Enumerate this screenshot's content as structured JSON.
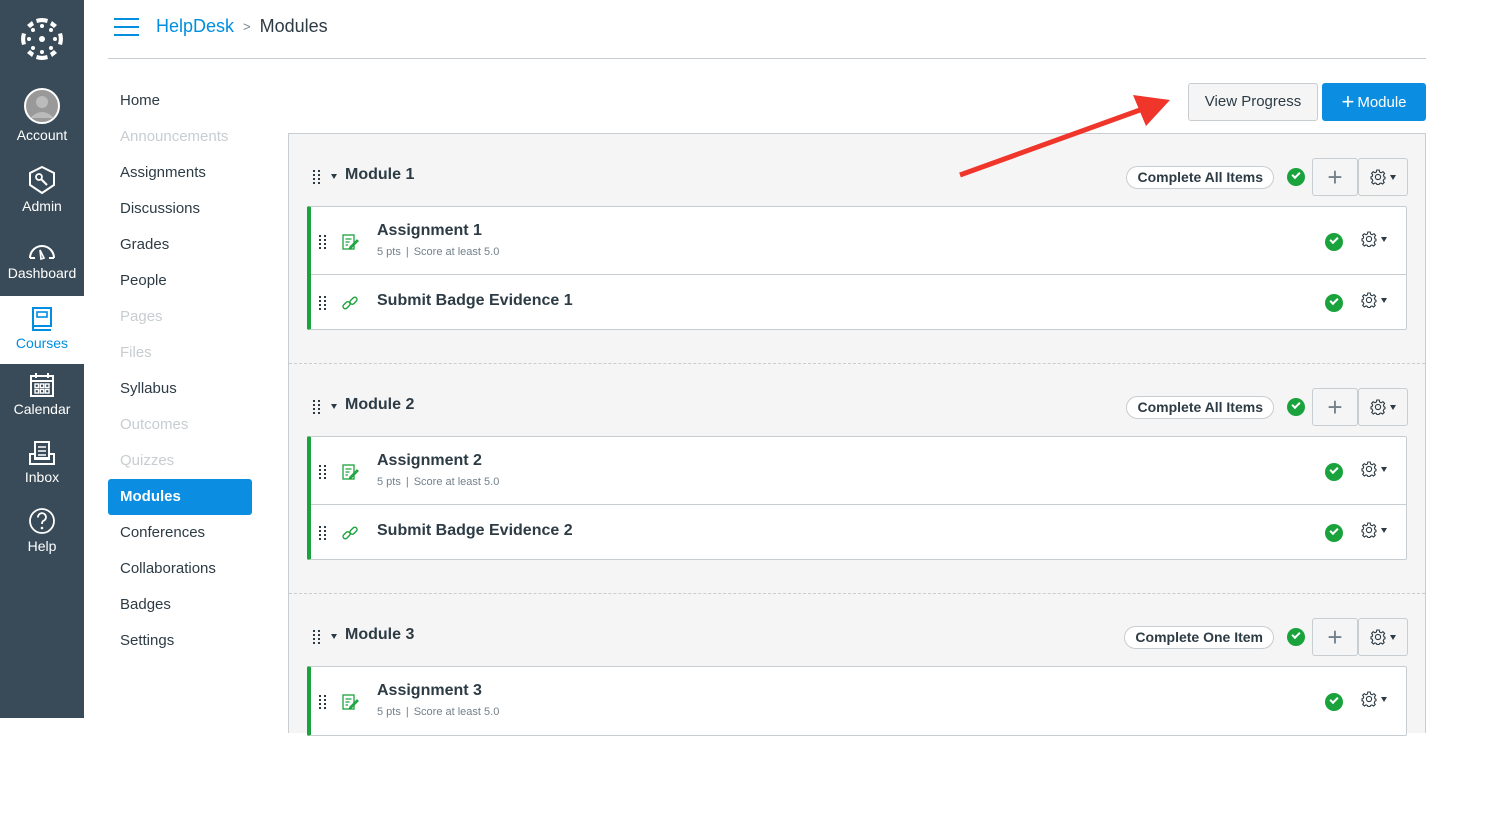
{
  "global_nav": {
    "items": [
      {
        "label": "Account",
        "icon": "avatar-icon"
      },
      {
        "label": "Admin",
        "icon": "shield-key-icon"
      },
      {
        "label": "Dashboard",
        "icon": "speedometer-icon"
      },
      {
        "label": "Courses",
        "icon": "book-icon",
        "active": true
      },
      {
        "label": "Calendar",
        "icon": "calendar-icon"
      },
      {
        "label": "Inbox",
        "icon": "inbox-icon"
      },
      {
        "label": "Help",
        "icon": "question-circle-icon"
      }
    ]
  },
  "breadcrumb": {
    "course": "HelpDesk",
    "separator": ">",
    "current": "Modules"
  },
  "course_nav": {
    "items": [
      {
        "label": "Home",
        "state": "enabled"
      },
      {
        "label": "Announcements",
        "state": "disabled"
      },
      {
        "label": "Assignments",
        "state": "enabled"
      },
      {
        "label": "Discussions",
        "state": "enabled"
      },
      {
        "label": "Grades",
        "state": "enabled"
      },
      {
        "label": "People",
        "state": "enabled"
      },
      {
        "label": "Pages",
        "state": "disabled"
      },
      {
        "label": "Files",
        "state": "disabled"
      },
      {
        "label": "Syllabus",
        "state": "enabled"
      },
      {
        "label": "Outcomes",
        "state": "disabled"
      },
      {
        "label": "Quizzes",
        "state": "disabled"
      },
      {
        "label": "Modules",
        "state": "active"
      },
      {
        "label": "Conferences",
        "state": "enabled"
      },
      {
        "label": "Collaborations",
        "state": "enabled"
      },
      {
        "label": "Badges",
        "state": "enabled"
      },
      {
        "label": "Settings",
        "state": "enabled"
      }
    ]
  },
  "toolbar": {
    "view_progress_label": "View Progress",
    "add_module_label": "Module",
    "add_module_icon": "+"
  },
  "modules": [
    {
      "title": "Module 1",
      "requirement": "Complete All Items",
      "items": [
        {
          "type": "assignment",
          "title": "Assignment 1",
          "points": "5 pts",
          "separator": "|",
          "requirement": "Score at least 5.0"
        },
        {
          "type": "link",
          "title": "Submit Badge Evidence 1"
        }
      ]
    },
    {
      "title": "Module 2",
      "requirement": "Complete All Items",
      "items": [
        {
          "type": "assignment",
          "title": "Assignment 2",
          "points": "5 pts",
          "separator": "|",
          "requirement": "Score at least 5.0"
        },
        {
          "type": "link",
          "title": "Submit Badge Evidence 2"
        }
      ]
    },
    {
      "title": "Module 3",
      "requirement": "Complete One Item",
      "items": [
        {
          "type": "assignment",
          "title": "Assignment 3",
          "points": "5 pts",
          "separator": "|",
          "requirement": "Score at least 5.0"
        }
      ]
    }
  ],
  "colors": {
    "primary": "#0b8ee2",
    "nav_bg": "#394b58",
    "success": "#1aa33c",
    "annotation_arrow": "#f0352a"
  }
}
